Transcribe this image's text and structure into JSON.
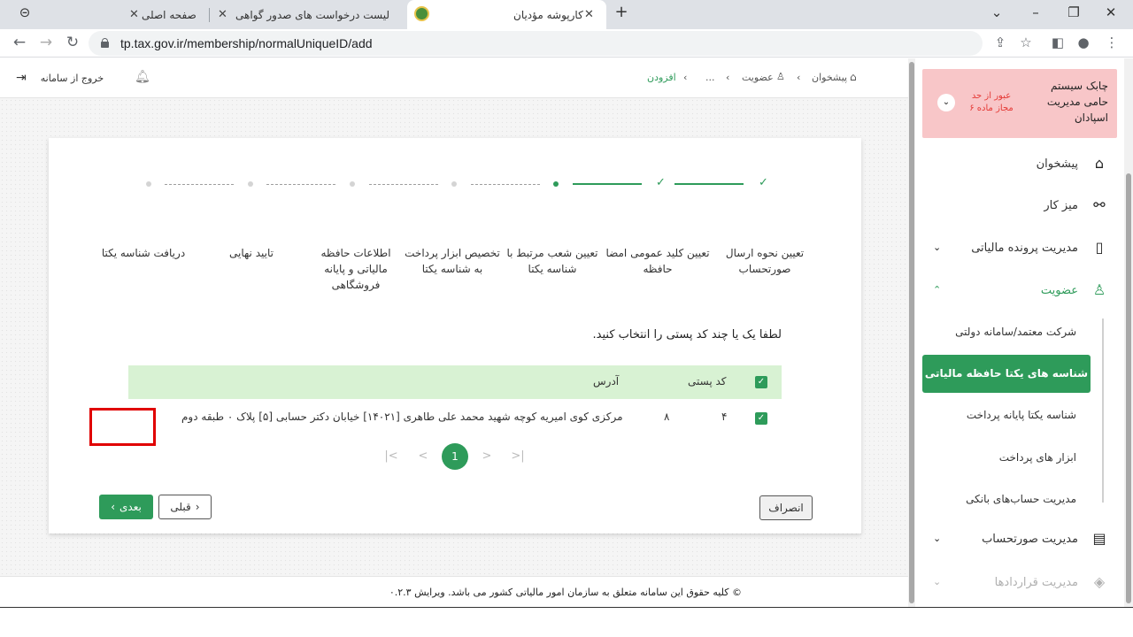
{
  "browser": {
    "tabs": [
      {
        "title": "صفحه اصلی",
        "close": "✕"
      },
      {
        "title": "لیست درخواست های صدور گواهی",
        "close": "✕"
      },
      {
        "title": "کارپوشه مؤدیان",
        "close": "✕"
      }
    ],
    "new_tab": "+",
    "url": "tp.tax.gov.ir/membership/normalUniqueID/add"
  },
  "header": {
    "breadcrumb": [
      "پیشخوان",
      "عضویت",
      "...",
      "افزودن"
    ],
    "logout_label": "خروج از سامانه"
  },
  "stepper": {
    "steps": [
      {
        "label": "تعیین نحوه ارسال صورتحساب"
      },
      {
        "label": "تعیین کلید عمومی امضا حافظه"
      },
      {
        "label": "تعیین شعب مرتبط با شناسه یکتا"
      },
      {
        "label": "تخصیص ابزار پرداخت به شناسه یکتا"
      },
      {
        "label": "اطلاعات حافظه مالیاتی و پایانه فروشگاهی"
      },
      {
        "label": "تایید نهایی"
      },
      {
        "label": "دریافت شناسه یکتا"
      }
    ]
  },
  "main": {
    "instruction": "لطفا یک یا چند کد پستی را انتخاب کنید.",
    "table": {
      "headers": {
        "postal_code": "کد پستی",
        "address": "آدرس"
      },
      "rows": [
        {
          "postal_code_start": "۸",
          "postal_code_end": "۴",
          "address": "مرکزی کوی امیریه کوچه شهید محمد علی طاهری [۱۴۰۲۱] خیابان دکتر حسابی [۵] پلاک ۰ طبقه دوم"
        }
      ]
    },
    "pagination": {
      "current": "1"
    },
    "buttons": {
      "next": "بعدی",
      "prev": "قبلی",
      "cancel": "انصراف"
    }
  },
  "footer": {
    "text": "© کلیه حقوق این سامانه متعلق به سازمان امور مالیاتی کشور می باشد. ویرایش ۰.۲.۳"
  },
  "sidebar": {
    "alert": {
      "title": "چابک سیستم حامی مدیریت اسپادان",
      "warning": "عبور از حد مجاز ماده ۶"
    },
    "items": [
      {
        "label": "پیشخوان"
      },
      {
        "label": "میز کار"
      },
      {
        "label": "مدیریت پرونده مالیاتی"
      },
      {
        "label": "عضویت"
      },
      {
        "label": "مدیریت صورتحساب"
      },
      {
        "label": "مدیریت قراردادها"
      }
    ],
    "sub_items": [
      {
        "label": "شرکت معتمد/سامانه دولتی"
      },
      {
        "label": "شناسه های یکتا حافظه مالیاتی"
      },
      {
        "label": "شناسه یکتا پایانه پرداخت"
      },
      {
        "label": "ابزار های پرداخت"
      },
      {
        "label": "مدیریت حساب‌های بانکی"
      }
    ]
  }
}
